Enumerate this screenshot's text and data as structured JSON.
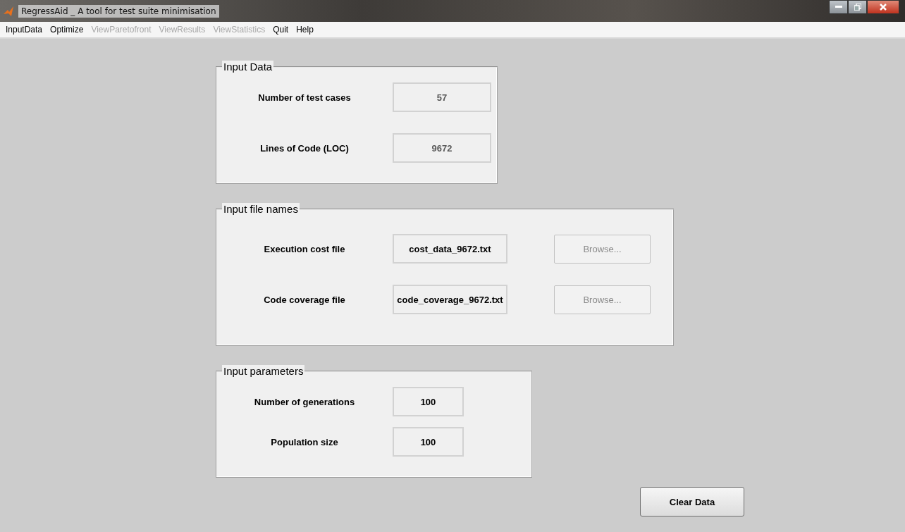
{
  "window": {
    "title": "RegressAid _ A tool for test suite minimisation"
  },
  "menu": [
    {
      "label": "InputData",
      "disabled": false
    },
    {
      "label": "Optimize",
      "disabled": false
    },
    {
      "label": "ViewParetofront",
      "disabled": true
    },
    {
      "label": "ViewResults",
      "disabled": true
    },
    {
      "label": "ViewStatistics",
      "disabled": true
    },
    {
      "label": "Quit",
      "disabled": false
    },
    {
      "label": "Help",
      "disabled": false
    }
  ],
  "panels": [
    {
      "title": "Input Data",
      "rows": [
        {
          "label": "Number of test cases",
          "field": {
            "value": "57",
            "disabled": true
          }
        },
        {
          "label": "Lines of Code (LOC)",
          "field": {
            "value": "9672",
            "disabled": true
          }
        }
      ]
    },
    {
      "title": "Input file names",
      "rows": [
        {
          "label": "Execution cost file",
          "field": {
            "value": "cost_data_9672.txt",
            "disabled": false
          },
          "button": {
            "label": "Browse...",
            "disabled": true
          }
        },
        {
          "label": "Code coverage file",
          "field": {
            "value": "code_coverage_9672.txt",
            "disabled": false
          },
          "button": {
            "label": "Browse...",
            "disabled": true
          }
        }
      ]
    },
    {
      "title": "Input parameters",
      "rows": [
        {
          "label": "Number of generations",
          "field": {
            "value": "100",
            "disabled": false
          }
        },
        {
          "label": "Population size",
          "field": {
            "value": "100",
            "disabled": false
          }
        }
      ]
    }
  ],
  "clear_button": {
    "label": "Clear Data",
    "disabled": false
  }
}
